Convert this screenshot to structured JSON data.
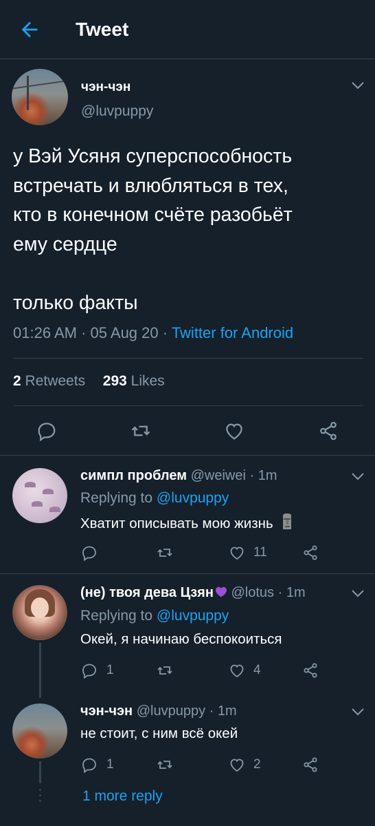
{
  "header": {
    "title": "Tweet"
  },
  "tweet": {
    "author_name": "чэн-чэн",
    "author_handle": "@luvpuppy",
    "text": "у Вэй Усяня суперспособность\nвстречать и влюбляться в тех,\nкто в конечном счёте разобьёт\nему сердце\n\nтолько факты",
    "time": "01:26 AM",
    "date": "05 Aug 20",
    "separator": "·",
    "source": "Twitter for Android",
    "retweets_count": "2",
    "retweets_label": "Retweets",
    "likes_count": "293",
    "likes_label": "Likes"
  },
  "replies": [
    {
      "name": "симпл проблем",
      "handle": "@weiwei",
      "time": "1m",
      "replying_label": "Replying to",
      "replying_to": "@luvpuppy",
      "text": "Хватит описывать мою жизнь",
      "emoji": "moai",
      "reply_count": "",
      "retweet_count": "",
      "like_count": "11"
    },
    {
      "name": "(не) твоя дева Цзян",
      "name_emoji": "purple-heart",
      "handle": "@lotus",
      "time": "1m",
      "replying_label": "Replying to",
      "replying_to": "@luvpuppy",
      "text": "Окей, я начинаю беспокоиться",
      "reply_count": "1",
      "retweet_count": "",
      "like_count": "4"
    },
    {
      "name": "чэн-чэн",
      "handle": "@luvpuppy",
      "time": "1m",
      "text": "не стоит, с ним всё окей",
      "reply_count": "1",
      "retweet_count": "",
      "like_count": "2"
    }
  ],
  "more_replies": "1 more reply",
  "colors": {
    "background": "#15202b",
    "divider": "#38444d",
    "muted": "#8899a6",
    "accent": "#1da1f2"
  }
}
